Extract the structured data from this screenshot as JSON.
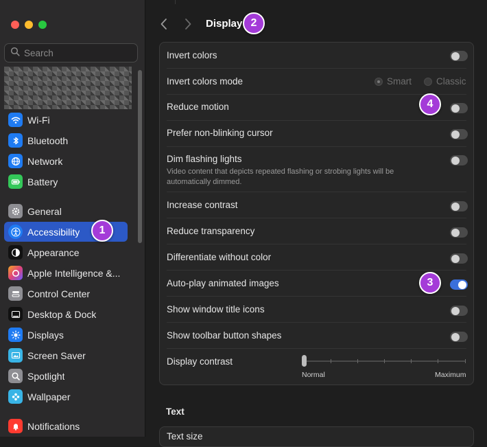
{
  "search": {
    "placeholder": "Search"
  },
  "sidebar": {
    "items": [
      {
        "label": "Wi-Fi",
        "icon": "wifi-icon",
        "color": "#1f7bf2"
      },
      {
        "label": "Bluetooth",
        "icon": "bluetooth-icon",
        "color": "#1f7bf2"
      },
      {
        "label": "Network",
        "icon": "globe-icon",
        "color": "#1f7bf2"
      },
      {
        "label": "Battery",
        "icon": "battery-icon",
        "color": "#34c759"
      },
      {
        "label": "General",
        "icon": "gear-icon",
        "color": "#8e8e93"
      },
      {
        "label": "Accessibility",
        "icon": "accessibility-icon",
        "color": "#1f7bf2",
        "selected": true
      },
      {
        "label": "Appearance",
        "icon": "appearance-icon",
        "color": "#111111"
      },
      {
        "label": "Apple Intelligence &...",
        "icon": "apple-intelligence-icon",
        "color": "#e0447a"
      },
      {
        "label": "Control Center",
        "icon": "control-center-icon",
        "color": "#8e8e93"
      },
      {
        "label": "Desktop & Dock",
        "icon": "dock-icon",
        "color": "#111111"
      },
      {
        "label": "Displays",
        "icon": "sun-icon",
        "color": "#1f7bf2"
      },
      {
        "label": "Screen Saver",
        "icon": "screen-saver-icon",
        "color": "#39b4e6"
      },
      {
        "label": "Spotlight",
        "icon": "magnifier-icon",
        "color": "#8e8e93"
      },
      {
        "label": "Wallpaper",
        "icon": "flower-icon",
        "color": "#39b4e6"
      },
      {
        "label": "Notifications",
        "icon": "bell-icon",
        "color": "#ff3b30"
      }
    ]
  },
  "header": {
    "title": "Display",
    "back_icon": "chevron-left-icon",
    "forward_icon": "chevron-right-icon"
  },
  "settings": {
    "invert_colors": {
      "label": "Invert colors",
      "on": false
    },
    "invert_mode": {
      "label": "Invert colors mode",
      "options": [
        "Smart",
        "Classic"
      ],
      "selected": "Smart"
    },
    "reduce_motion": {
      "label": "Reduce motion",
      "on": false
    },
    "non_blinking": {
      "label": "Prefer non-blinking cursor",
      "on": false
    },
    "dim_flashing": {
      "label": "Dim flashing lights",
      "description": "Video content that depicts repeated flashing or strobing lights will be automatically dimmed.",
      "on": false
    },
    "increase_contrast": {
      "label": "Increase contrast",
      "on": false
    },
    "reduce_transparency": {
      "label": "Reduce transparency",
      "on": false
    },
    "differentiate": {
      "label": "Differentiate without color",
      "on": false
    },
    "autoplay": {
      "label": "Auto-play animated images",
      "on": true
    },
    "title_icons": {
      "label": "Show window title icons",
      "on": false
    },
    "toolbar_shapes": {
      "label": "Show toolbar button shapes",
      "on": false
    },
    "display_contrast": {
      "label": "Display contrast",
      "min_label": "Normal",
      "max_label": "Maximum",
      "value": 0
    }
  },
  "text_section": {
    "title": "Text",
    "first_row": "Text size"
  },
  "badges": [
    "1",
    "2",
    "3",
    "4"
  ],
  "colors": {
    "accent": "#2c59c6",
    "toggle_on": "#3a6fdb",
    "badge": "#a43bd8"
  }
}
